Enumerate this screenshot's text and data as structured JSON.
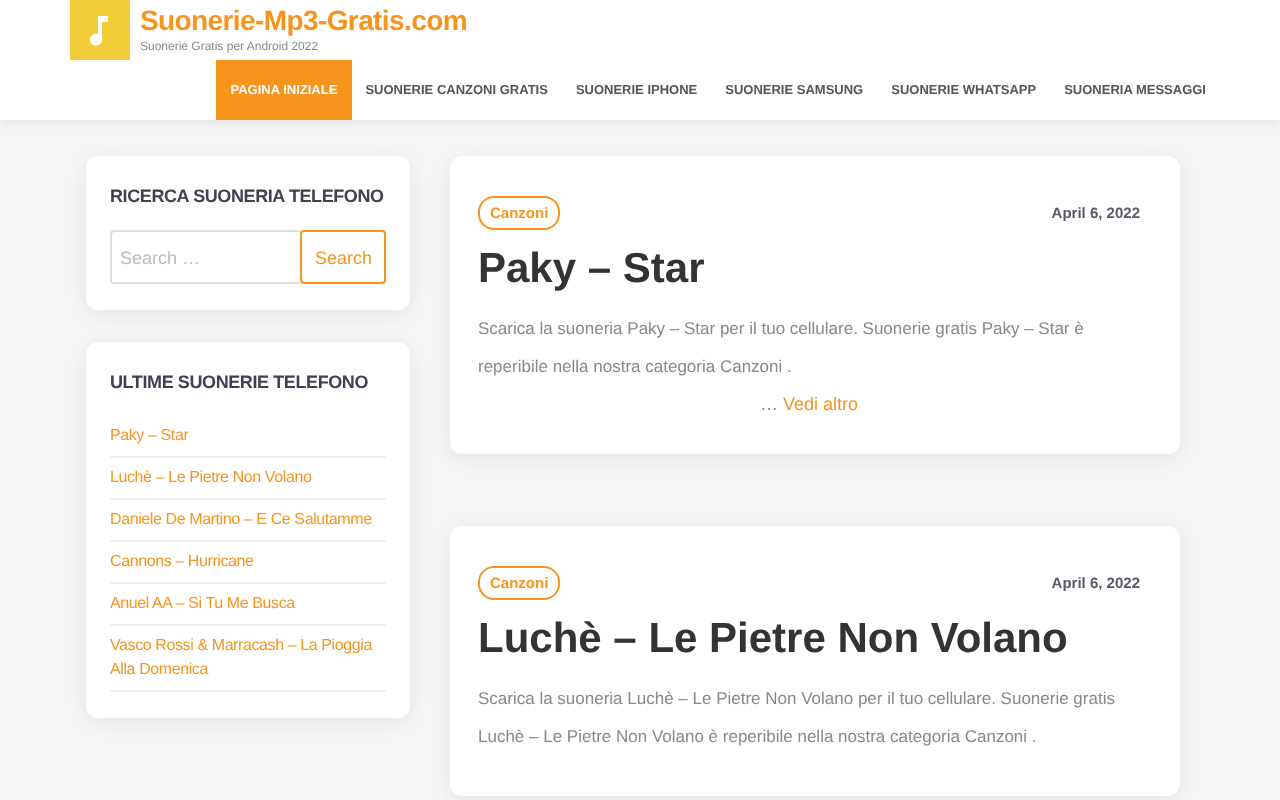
{
  "site": {
    "title": "Suonerie-Mp3-Gratis.com",
    "tagline": "Suonerie Gratis per Android 2022"
  },
  "nav": [
    {
      "label": "PAGINA INIZIALE",
      "selected": true
    },
    {
      "label": "SUONERIE CANZONI GRATIS",
      "selected": false
    },
    {
      "label": "SUONERIE IPHONE",
      "selected": false
    },
    {
      "label": "SUONERIE SAMSUNG",
      "selected": false
    },
    {
      "label": "SUONERIE WHATSAPP",
      "selected": false
    },
    {
      "label": "SUONERIA MESSAGGI",
      "selected": false
    }
  ],
  "sidebar": {
    "search_widget": {
      "title": "RICERCA SUONERIA TELEFONO",
      "placeholder": "Search …",
      "button": "Search"
    },
    "recent_widget": {
      "title": "ULTIME SUONERIE TELEFONO",
      "items": [
        "Paky – Star",
        "Luchè – Le Pietre Non Volano",
        "Daniele De Martino – E Ce Salutamme",
        "Cannons – Hurricane",
        "Anuel AA – Si Tu Me Busca",
        "Vasco Rossi & Marracash – La Pioggia Alla Domenica"
      ]
    }
  },
  "posts": [
    {
      "category": "Canzoni",
      "date": "April 6, 2022",
      "title": "Paky – Star",
      "excerpt": "Scarica la suoneria Paky – Star per il tuo cellulare. Suonerie gratis Paky – Star è reperibile nella nostra categoria Canzoni .",
      "more_prefix": "…",
      "more": "Vedi altro"
    },
    {
      "category": "Canzoni",
      "date": "April 6, 2022",
      "title": "Luchè – Le Pietre Non Volano",
      "excerpt": "Scarica la suoneria Luchè – Le Pietre Non Volano per il tuo cellulare. Suonerie gratis Luchè – Le Pietre Non Volano è reperibile nella nostra categoria Canzoni ."
    }
  ]
}
